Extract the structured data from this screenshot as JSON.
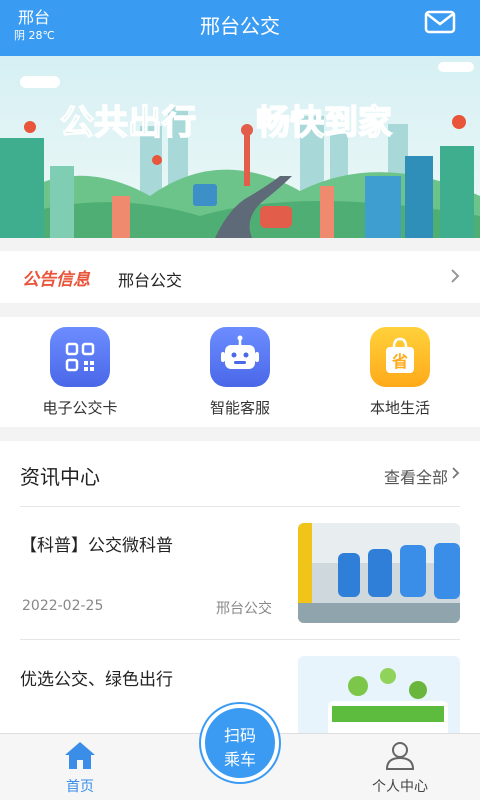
{
  "header": {
    "city": "邢台",
    "weather": "阴 28℃",
    "title": "邢台公交"
  },
  "banner": {
    "slogan_left": "公共出行",
    "slogan_right": "畅快到家"
  },
  "notice": {
    "tag": "公告信息",
    "text": "邢台公交"
  },
  "features": [
    {
      "label": "电子公交卡",
      "icon": "qr-card-icon"
    },
    {
      "label": "智能客服",
      "icon": "robot-icon"
    },
    {
      "label": "本地生活",
      "icon": "shopping-bag-icon"
    }
  ],
  "news": {
    "title": "资讯中心",
    "more": "查看全部",
    "items": [
      {
        "title": "【科普】公交微科普",
        "date": "2022-02-25",
        "source": "邢台公交"
      },
      {
        "title": "优选公交、绿色出行"
      }
    ]
  },
  "bottom_nav": {
    "home": "首页",
    "scan_line1": "扫码",
    "scan_line2": "乘车",
    "me": "个人中心"
  },
  "colors": {
    "primary": "#3a9bf2",
    "notice_tag": "#e8553a",
    "feature_blue": "#5a78f0",
    "feature_orange": "#ffb623"
  }
}
